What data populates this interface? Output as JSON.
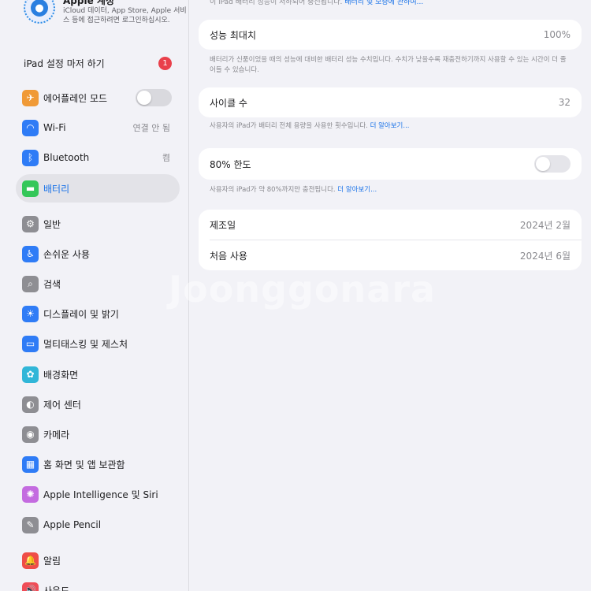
{
  "sidebar": {
    "account": {
      "title": "Apple 계정",
      "subtitle": "iCloud 데이터, App Store, Apple 서비스 등에 접근하려면 로그인하십시오.",
      "avatar_icon": "apple-logo-icon"
    },
    "setup": {
      "label": "iPad 설정 마저 하기",
      "badge": "1"
    },
    "items": [
      {
        "key": "airplane",
        "label": "에어플레인 모드",
        "icon": "airplane-icon",
        "icon_glyph": "✈",
        "color": "#f09a37",
        "toggle": false
      },
      {
        "key": "wifi",
        "label": "Wi-Fi",
        "value": "연결 안 됨",
        "icon": "wifi-icon",
        "icon_glyph": "◠",
        "color": "#2f7cf6"
      },
      {
        "key": "bluetooth",
        "label": "Bluetooth",
        "value": "켬",
        "icon": "bluetooth-icon",
        "icon_glyph": "ᛒ",
        "color": "#2f7cf6"
      },
      {
        "key": "battery",
        "label": "배터리",
        "icon": "battery-icon",
        "icon_glyph": "▬",
        "color": "#34c759",
        "selected": true
      },
      {
        "key": "general",
        "label": "일반",
        "icon": "gear-icon",
        "icon_glyph": "⚙",
        "color": "#8e8e93"
      },
      {
        "key": "accessibility",
        "label": "손쉬운 사용",
        "icon": "accessibility-icon",
        "icon_glyph": "♿",
        "color": "#2f7cf6"
      },
      {
        "key": "search",
        "label": "검색",
        "icon": "search-icon",
        "icon_glyph": "⌕",
        "color": "#8e8e93"
      },
      {
        "key": "display",
        "label": "디스플레이 및 밝기",
        "icon": "sun-icon",
        "icon_glyph": "☀",
        "color": "#2f7cf6"
      },
      {
        "key": "multitasking",
        "label": "멀티태스킹 및 제스처",
        "icon": "multitasking-icon",
        "icon_glyph": "▭",
        "color": "#2f7cf6"
      },
      {
        "key": "wallpaper",
        "label": "배경화면",
        "icon": "wallpaper-icon",
        "icon_glyph": "✿",
        "color": "#31b6d8"
      },
      {
        "key": "control_center",
        "label": "제어 센터",
        "icon": "control-center-icon",
        "icon_glyph": "◐",
        "color": "#8e8e93"
      },
      {
        "key": "camera",
        "label": "카메라",
        "icon": "camera-icon",
        "icon_glyph": "◉",
        "color": "#8e8e93"
      },
      {
        "key": "home_screen",
        "label": "홈 화면 및 앱 보관함",
        "icon": "home-screen-icon",
        "icon_glyph": "▦",
        "color": "#2f7cf6"
      },
      {
        "key": "apple_intelligence",
        "label": "Apple Intelligence 및 Siri",
        "icon": "siri-icon",
        "icon_glyph": "✺",
        "color": "#c46be0"
      },
      {
        "key": "apple_pencil",
        "label": "Apple Pencil",
        "icon": "pencil-icon",
        "icon_glyph": "✎",
        "color": "#8e8e93"
      },
      {
        "key": "notifications",
        "label": "알림",
        "icon": "bell-icon",
        "icon_glyph": "🔔",
        "color": "#ef4d47"
      },
      {
        "key": "sounds",
        "label": "사운드",
        "icon": "speaker-icon",
        "icon_glyph": "🔊",
        "color": "#ef4d57"
      }
    ]
  },
  "main": {
    "top_note": {
      "text": "이 iPad 배터리 성능이 저하되어 충전됩니다.",
      "link": "배터리 및 보증에 관하여..."
    },
    "max_capacity": {
      "title": "성능 최대치",
      "value": "100%",
      "footnote": "배터리가 신품이었을 때의 성능에 대비한 배터리 성능 수치입니다. 수치가 낮을수록 재충전하기까지 사용할 수 있는 시간이 더 줄어들 수 있습니다."
    },
    "cycle_count": {
      "title": "사이클 수",
      "value": "32",
      "footnote": "사용자의 iPad가 배터리 전체 용량을 사용한 횟수입니다.",
      "link": "더 알아보기..."
    },
    "limit80": {
      "title": "80% 한도",
      "toggle": false,
      "footnote": "사용자의 iPad가 약 80%까지만 충전됩니다.",
      "link": "더 알아보기..."
    },
    "dates": {
      "manufactured_label": "제조일",
      "manufactured_value": "2024년 2월",
      "first_use_label": "처음 사용",
      "first_use_value": "2024년 6월"
    }
  },
  "watermark": "Joonggonara"
}
